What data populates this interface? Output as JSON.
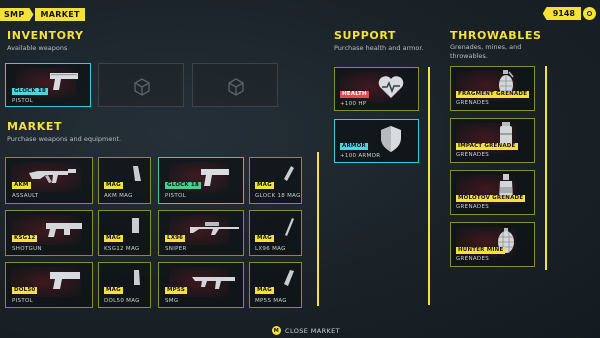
{
  "breadcrumb": {
    "first": "SMP",
    "second": "MARKET"
  },
  "currency": {
    "amount": "9148",
    "icon": "coin-icon"
  },
  "inventory": {
    "title": "INVENTORY",
    "subtitle": "Available weapons",
    "slots": [
      {
        "tag": "GLOCK 18",
        "name": "PISTOL",
        "icon": "pistol-icon"
      },
      {
        "empty": true,
        "icon": "box-icon"
      },
      {
        "empty": true,
        "icon": "box-icon"
      }
    ]
  },
  "market": {
    "title": "MARKET",
    "subtitle": "Purchase weapons and equipment.",
    "items": [
      {
        "tag": "AKM",
        "name": "ASSAULT",
        "icon": "rifle-icon"
      },
      {
        "tag": "MAG",
        "name": "AKM MAG",
        "icon": "magazine-icon"
      },
      {
        "tag": "GLOCK 18",
        "name": "PISTOL",
        "icon": "pistol-icon"
      },
      {
        "tag": "MAG",
        "name": "GLOCK 18 MAG",
        "icon": "magazine-icon"
      },
      {
        "tag": "KSG12",
        "name": "SHOTGUN",
        "icon": "shotgun-icon"
      },
      {
        "tag": "MAG",
        "name": "KSG12 MAG",
        "icon": "magazine-icon"
      },
      {
        "tag": "LX96",
        "name": "SNIPER",
        "icon": "sniper-icon"
      },
      {
        "tag": "MAG",
        "name": "LX96 MAG",
        "icon": "magazine-icon"
      },
      {
        "tag": "DOL50",
        "name": "PISTOL",
        "icon": "pistol-icon"
      },
      {
        "tag": "MAG",
        "name": "DOL50 MAG",
        "icon": "magazine-icon"
      },
      {
        "tag": "MP5S",
        "name": "SMG",
        "icon": "smg-icon"
      },
      {
        "tag": "MAG",
        "name": "MP5S MAG",
        "icon": "magazine-icon"
      }
    ]
  },
  "support": {
    "title": "SUPPORT",
    "subtitle": "Purchase health and armor.",
    "items": [
      {
        "tag": "HEALTH",
        "name": "+100 HP",
        "icon": "heart-icon"
      },
      {
        "tag": "ARMOR",
        "name": "+100 ARMOR",
        "icon": "shield-icon"
      }
    ]
  },
  "throwables": {
    "title": "THROWABLES",
    "subtitle": "Grenades, mines, and throwables.",
    "items": [
      {
        "tag": "FRAGMENT GRENADE",
        "name": "GRENADES",
        "icon": "frag-grenade-icon"
      },
      {
        "tag": "IMPACT GRENADE",
        "name": "GRENADES",
        "icon": "impact-grenade-icon"
      },
      {
        "tag": "MOLOTOV GRENADE",
        "name": "GRENADES",
        "icon": "molotov-icon"
      },
      {
        "tag": "HUNTER MINE",
        "name": "GRENADES",
        "icon": "mine-icon"
      }
    ]
  },
  "footer": {
    "key": "M",
    "label": "CLOSE MARKET"
  },
  "colors": {
    "accent": "#f4e23a",
    "selected_cyan": "#3ec8d8",
    "selected_green": "#47c98a",
    "health_red": "#e04a55"
  }
}
